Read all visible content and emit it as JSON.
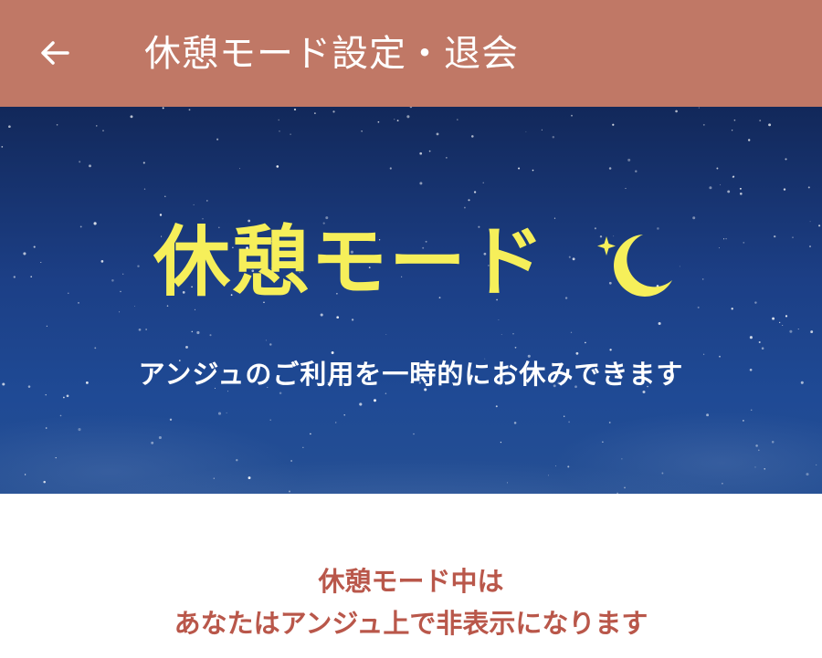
{
  "header": {
    "back_icon": "arrow-left-icon",
    "title": "休憩モード設定・退会",
    "background_color": "#c07866"
  },
  "banner": {
    "title": "休憩モード",
    "moon_icon": "crescent-moon-icon",
    "subtitle": "アンジュのご利用を一時的にお休みできます",
    "title_color": "#f6ef5a",
    "background_color": "#1c3f86"
  },
  "notice": {
    "line1": "休憩モード中は",
    "line2": "あなたはアンジュ上で非表示になります",
    "color": "#b9574a"
  }
}
